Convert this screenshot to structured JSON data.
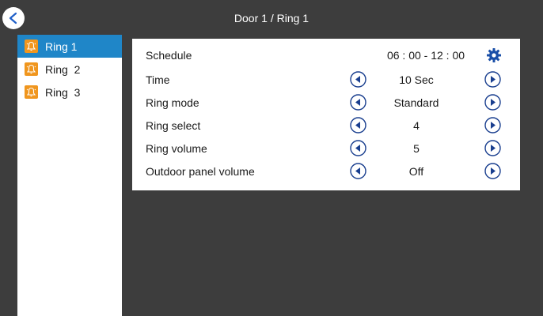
{
  "header": {
    "title": "Door 1 / Ring 1",
    "back_icon": "chevron-left-icon"
  },
  "sidebar": {
    "items": [
      {
        "label": "Ring 1",
        "icon": "bell-icon",
        "active": true
      },
      {
        "label": "Ring  2",
        "icon": "bell-icon",
        "active": false
      },
      {
        "label": "Ring  3",
        "icon": "bell-icon",
        "active": false
      }
    ]
  },
  "settings": {
    "schedule": {
      "label": "Schedule",
      "value": "06 : 00 - 12 : 00",
      "icon": "gear-icon"
    },
    "rows": [
      {
        "label": "Time",
        "value": "10 Sec"
      },
      {
        "label": "Ring mode",
        "value": "Standard"
      },
      {
        "label": "Ring select",
        "value": "4"
      },
      {
        "label": "Ring volume",
        "value": "5"
      },
      {
        "label": "Outdoor panel volume",
        "value": "Off"
      }
    ]
  },
  "colors": {
    "background": "#3d3d3d",
    "accent": "#1f86c8",
    "bell": "#f0961e",
    "arrow": "#1a3f8f"
  }
}
